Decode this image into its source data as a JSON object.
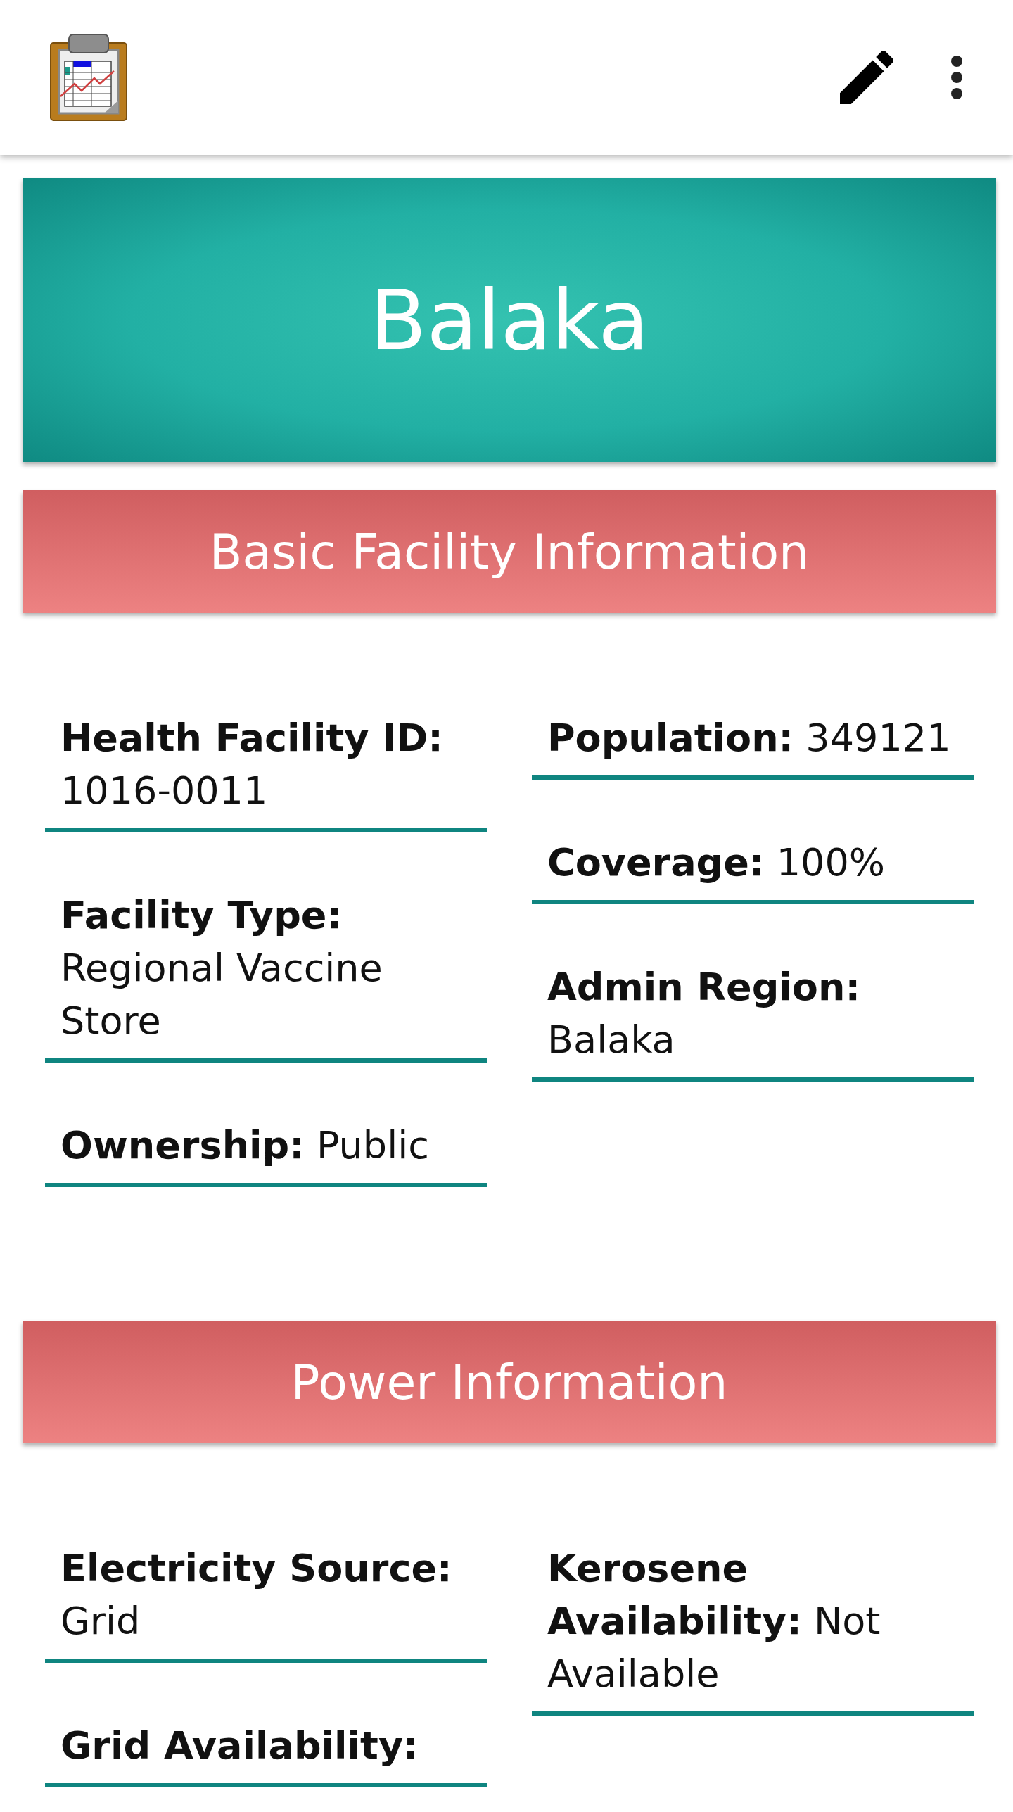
{
  "title": "Balaka",
  "sections": [
    {
      "title": "Basic Facility Information",
      "columns": [
        [
          {
            "label": "Health Facility ID:",
            "value": "1016-0011"
          },
          {
            "label": "Facility Type:",
            "value": "Regional Vaccine Store"
          },
          {
            "label": "Ownership:",
            "value": "Public"
          }
        ],
        [
          {
            "label": "Population:",
            "value": "349121"
          },
          {
            "label": "Coverage:",
            "value": "100%"
          },
          {
            "label": "Admin Region:",
            "value": "Balaka"
          }
        ]
      ]
    },
    {
      "title": "Power Information",
      "columns": [
        [
          {
            "label": "Electricity Source:",
            "value": "Grid"
          },
          {
            "label": "Grid Availability:"
          }
        ],
        [
          {
            "label": "Kerosene Availability:",
            "value": "Not Available"
          }
        ]
      ]
    }
  ]
}
